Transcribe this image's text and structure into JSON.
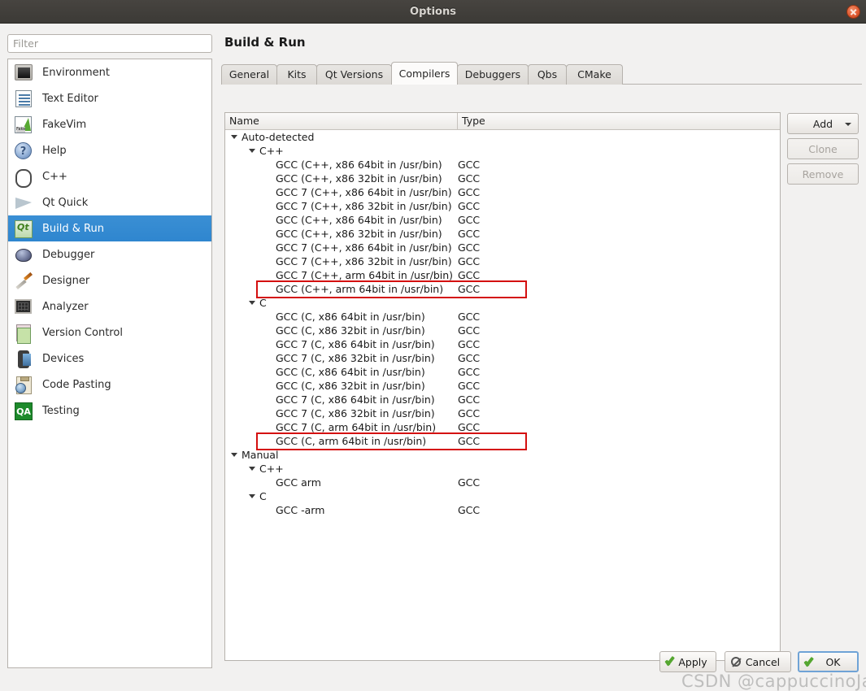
{
  "window": {
    "title": "Options",
    "close_icon": "close-icon"
  },
  "sidebar": {
    "filter_placeholder": "Filter",
    "filter_value": "",
    "items": [
      {
        "label": "Environment",
        "icon": "monitor-icon",
        "selected": false
      },
      {
        "label": "Text Editor",
        "icon": "document-text-icon",
        "selected": false
      },
      {
        "label": "FakeVim",
        "icon": "fakevim-icon",
        "selected": false
      },
      {
        "label": "Help",
        "icon": "question-mark-icon",
        "selected": false
      },
      {
        "label": "C++",
        "icon": "braces-icon",
        "selected": false
      },
      {
        "label": "Qt Quick",
        "icon": "paper-plane-icon",
        "selected": false
      },
      {
        "label": "Build & Run",
        "icon": "qt-build-icon",
        "selected": true
      },
      {
        "label": "Debugger",
        "icon": "bug-icon",
        "selected": false
      },
      {
        "label": "Designer",
        "icon": "paintbrush-icon",
        "selected": false
      },
      {
        "label": "Analyzer",
        "icon": "grid-chart-icon",
        "selected": false
      },
      {
        "label": "Version Control",
        "icon": "documents-icon",
        "selected": false
      },
      {
        "label": "Devices",
        "icon": "phone-icon",
        "selected": false
      },
      {
        "label": "Code Pasting",
        "icon": "clipboard-globe-icon",
        "selected": false
      },
      {
        "label": "Testing",
        "icon": "qa-badge-icon",
        "selected": false
      }
    ]
  },
  "main": {
    "page_title": "Build & Run",
    "tabs": [
      {
        "label": "General",
        "active": false
      },
      {
        "label": "Kits",
        "active": false
      },
      {
        "label": "Qt Versions",
        "active": false
      },
      {
        "label": "Compilers",
        "active": true
      },
      {
        "label": "Debuggers",
        "active": false
      },
      {
        "label": "Qbs",
        "active": false
      },
      {
        "label": "CMake",
        "active": false
      }
    ],
    "columns": {
      "name": "Name",
      "type": "Type"
    },
    "tree": [
      {
        "level": 0,
        "expander": true,
        "name": "Auto-detected",
        "type": "",
        "highlight": false
      },
      {
        "level": 1,
        "expander": true,
        "name": "C++",
        "type": "",
        "highlight": false
      },
      {
        "level": 2,
        "expander": false,
        "name": "GCC (C++, x86 64bit in /usr/bin)",
        "type": "GCC",
        "highlight": false
      },
      {
        "level": 2,
        "expander": false,
        "name": "GCC (C++, x86 32bit in /usr/bin)",
        "type": "GCC",
        "highlight": false
      },
      {
        "level": 2,
        "expander": false,
        "name": "GCC 7 (C++, x86 64bit in /usr/bin)",
        "type": "GCC",
        "highlight": false
      },
      {
        "level": 2,
        "expander": false,
        "name": "GCC 7 (C++, x86 32bit in /usr/bin)",
        "type": "GCC",
        "highlight": false
      },
      {
        "level": 2,
        "expander": false,
        "name": "GCC (C++, x86 64bit in /usr/bin)",
        "type": "GCC",
        "highlight": false
      },
      {
        "level": 2,
        "expander": false,
        "name": "GCC (C++, x86 32bit in /usr/bin)",
        "type": "GCC",
        "highlight": false
      },
      {
        "level": 2,
        "expander": false,
        "name": "GCC 7 (C++, x86 64bit in /usr/bin)",
        "type": "GCC",
        "highlight": false
      },
      {
        "level": 2,
        "expander": false,
        "name": "GCC 7 (C++, x86 32bit in /usr/bin)",
        "type": "GCC",
        "highlight": false
      },
      {
        "level": 2,
        "expander": false,
        "name": "GCC 7 (C++, arm 64bit in /usr/bin)",
        "type": "GCC",
        "highlight": false
      },
      {
        "level": 2,
        "expander": false,
        "name": "GCC (C++, arm 64bit in /usr/bin)",
        "type": "GCC",
        "highlight": true
      },
      {
        "level": 1,
        "expander": true,
        "name": "C",
        "type": "",
        "highlight": false
      },
      {
        "level": 2,
        "expander": false,
        "name": "GCC (C, x86 64bit in /usr/bin)",
        "type": "GCC",
        "highlight": false
      },
      {
        "level": 2,
        "expander": false,
        "name": "GCC (C, x86 32bit in /usr/bin)",
        "type": "GCC",
        "highlight": false
      },
      {
        "level": 2,
        "expander": false,
        "name": "GCC 7 (C, x86 64bit in /usr/bin)",
        "type": "GCC",
        "highlight": false
      },
      {
        "level": 2,
        "expander": false,
        "name": "GCC 7 (C, x86 32bit in /usr/bin)",
        "type": "GCC",
        "highlight": false
      },
      {
        "level": 2,
        "expander": false,
        "name": "GCC (C, x86 64bit in /usr/bin)",
        "type": "GCC",
        "highlight": false
      },
      {
        "level": 2,
        "expander": false,
        "name": "GCC (C, x86 32bit in /usr/bin)",
        "type": "GCC",
        "highlight": false
      },
      {
        "level": 2,
        "expander": false,
        "name": "GCC 7 (C, x86 64bit in /usr/bin)",
        "type": "GCC",
        "highlight": false
      },
      {
        "level": 2,
        "expander": false,
        "name": "GCC 7 (C, x86 32bit in /usr/bin)",
        "type": "GCC",
        "highlight": false
      },
      {
        "level": 2,
        "expander": false,
        "name": "GCC 7 (C, arm 64bit in /usr/bin)",
        "type": "GCC",
        "highlight": false
      },
      {
        "level": 2,
        "expander": false,
        "name": "GCC (C, arm 64bit in /usr/bin)",
        "type": "GCC",
        "highlight": true
      },
      {
        "level": 0,
        "expander": true,
        "name": "Manual",
        "type": "",
        "highlight": false
      },
      {
        "level": 1,
        "expander": true,
        "name": "C++",
        "type": "",
        "highlight": false
      },
      {
        "level": 2,
        "expander": false,
        "name": "GCC arm",
        "type": "GCC",
        "highlight": false
      },
      {
        "level": 1,
        "expander": true,
        "name": "C",
        "type": "",
        "highlight": false
      },
      {
        "level": 2,
        "expander": false,
        "name": "GCC -arm",
        "type": "GCC",
        "highlight": false
      }
    ],
    "side_buttons": [
      {
        "label": "Add",
        "enabled": true,
        "has_menu": true
      },
      {
        "label": "Clone",
        "enabled": false,
        "has_menu": false
      },
      {
        "label": "Remove",
        "enabled": false,
        "has_menu": false
      }
    ]
  },
  "footer": {
    "apply": "Apply",
    "cancel": "Cancel",
    "ok": "OK"
  },
  "watermark": {
    "text": "CSDN @cappuccinoJay"
  },
  "colors": {
    "selection": "#2f86cf",
    "highlight_box": "#d40f0f",
    "titlebar": "#3c3a36",
    "window_bg": "#f2f1f0"
  }
}
